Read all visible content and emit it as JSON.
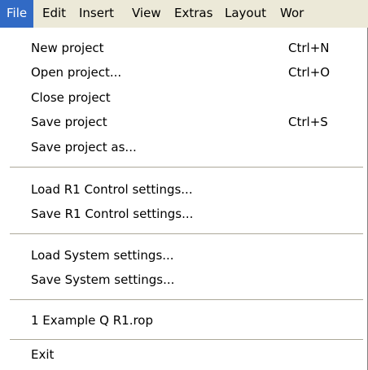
{
  "menubar": {
    "items": [
      "File",
      "Edit",
      "Insert",
      "View",
      "Extras",
      "Layout",
      "Wor"
    ],
    "active": "File"
  },
  "file_menu": {
    "items": [
      {
        "label": "New project",
        "shortcut": "Ctrl+N"
      },
      {
        "label": "Open project...",
        "shortcut": "Ctrl+O"
      },
      {
        "label": "Close project",
        "shortcut": ""
      },
      {
        "label": "Save project",
        "shortcut": "Ctrl+S"
      },
      {
        "label": "Save project as...",
        "shortcut": ""
      },
      {
        "label": "Load R1 Control settings...",
        "shortcut": ""
      },
      {
        "label": "Save R1 Control settings...",
        "shortcut": ""
      },
      {
        "label": "Load System settings...",
        "shortcut": ""
      },
      {
        "label": "Save System settings...",
        "shortcut": ""
      },
      {
        "label": "1 Example Q R1.rop",
        "shortcut": ""
      },
      {
        "label": "Exit",
        "shortcut": ""
      }
    ]
  },
  "colors": {
    "highlight": "#316ac5",
    "menubar_bg": "#ece9d8"
  }
}
